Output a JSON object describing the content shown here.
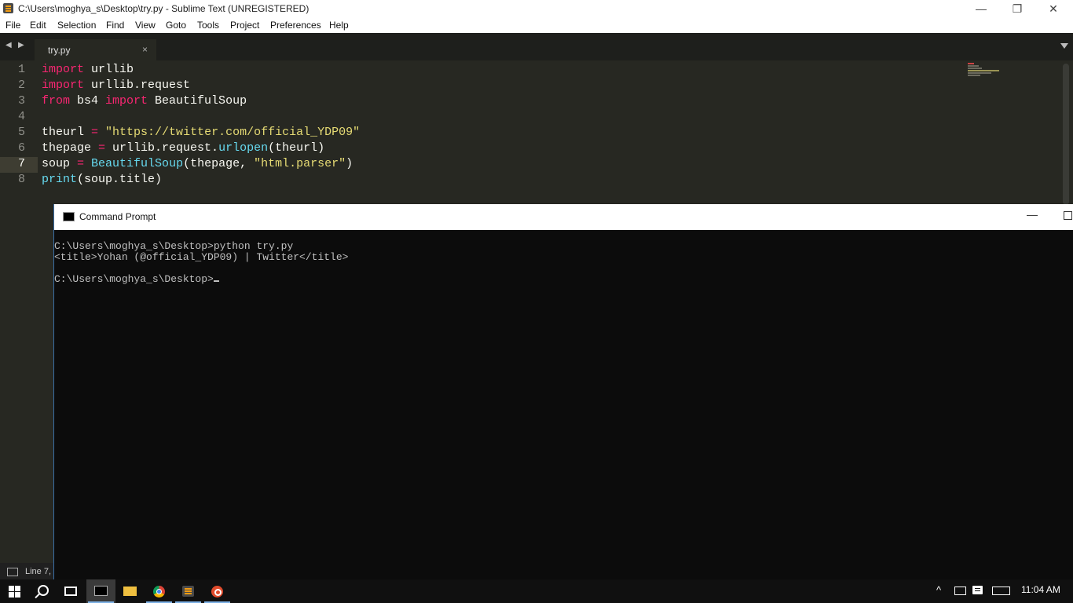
{
  "window": {
    "title": "C:\\Users\\moghya_s\\Desktop\\try.py - Sublime Text (UNREGISTERED)",
    "minimize": "—",
    "restore": "❐",
    "close": "✕"
  },
  "menu": [
    "File",
    "Edit",
    "Selection",
    "Find",
    "View",
    "Goto",
    "Tools",
    "Project",
    "Preferences",
    "Help"
  ],
  "tabs": {
    "active_label": "try.py",
    "close_glyph": "×",
    "back": "◀",
    "forward": "▶"
  },
  "editor": {
    "line_numbers": [
      "1",
      "2",
      "3",
      "4",
      "5",
      "6",
      "7",
      "8"
    ],
    "current_line": "7",
    "code": {
      "l1_kw": "import",
      "l1_rest": " urllib",
      "l2_kw": "import",
      "l2_rest": " urllib.request",
      "l3_kw1": "from",
      "l3_mid": " bs4 ",
      "l3_kw2": "import",
      "l3_rest": " BeautifulSoup",
      "l5_a": "theurl ",
      "l5_op": "=",
      "l5_sp": " ",
      "l5_str": "\"https://twitter.com/official_YDP09\"",
      "l6_a": "thepage ",
      "l6_op": "=",
      "l6_b": " urllib.request.",
      "l6_fn": "urlopen",
      "l6_c": "(theurl)",
      "l7_a": "soup ",
      "l7_op": "=",
      "l7_sp": " ",
      "l7_fn": "BeautifulSoup",
      "l7_b": "(thepage, ",
      "l7_str": "\"html.parser\"",
      "l7_c": ")",
      "l8_fn": "print",
      "l8_rest": "(soup.title)"
    }
  },
  "status": {
    "text": "Line 7,"
  },
  "cmd": {
    "title": "Command Prompt",
    "lines": [
      "C:\\Users\\moghya_s\\Desktop>python try.py",
      "<title>Yohan (@official_YDP09) | Twitter</title>",
      "",
      "C:\\Users\\moghya_s\\Desktop>"
    ],
    "min": "—"
  },
  "taskbar": {
    "clock": "11:04 AM",
    "tray_up": "^"
  },
  "colors": {
    "editor_bg": "#272822",
    "keyword": "#f92672",
    "string": "#e6db74",
    "function": "#66d9ef",
    "cmd_bg": "#0c0c0c"
  }
}
